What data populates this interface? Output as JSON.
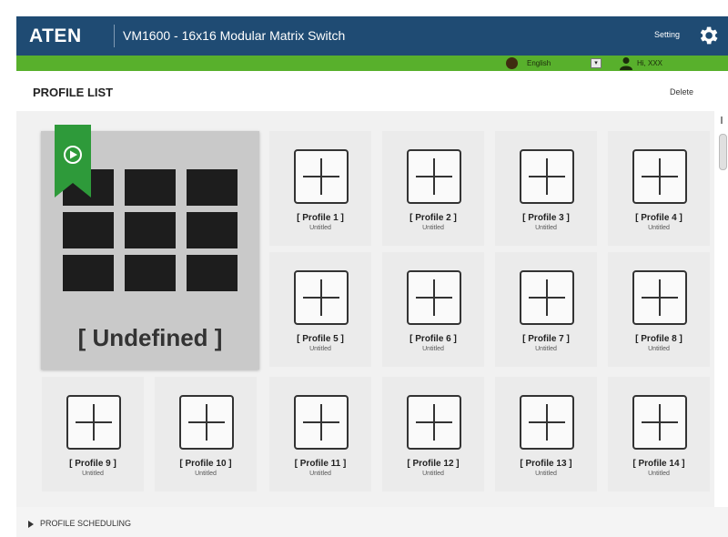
{
  "header": {
    "logo": "ATEN",
    "title": "VM1600 - 16x16 Modular Matrix Switch",
    "setting_label": "Setting",
    "bar_color": "#1f4b73",
    "setting_icon": "gear-icon"
  },
  "toolbar": {
    "language_icon": "globe-icon",
    "language": "English",
    "user_icon": "user-icon",
    "user": "Hi, XXX",
    "accent_color": "#58b02c"
  },
  "profile_list": {
    "title": "PROFILE LIST",
    "delete_label": "Delete",
    "active_profile": {
      "name": "[ Undefined ]",
      "play_icon": "play-icon"
    },
    "profiles": [
      {
        "name": "[ Profile 1 ]",
        "sub": "Untitled"
      },
      {
        "name": "[ Profile 2 ]",
        "sub": "Untitled"
      },
      {
        "name": "[ Profile 3 ]",
        "sub": "Untitled"
      },
      {
        "name": "[ Profile 4 ]",
        "sub": "Untitled"
      },
      {
        "name": "[ Profile 5 ]",
        "sub": "Untitled"
      },
      {
        "name": "[ Profile 6 ]",
        "sub": "Untitled"
      },
      {
        "name": "[ Profile 7 ]",
        "sub": "Untitled"
      },
      {
        "name": "[ Profile 8 ]",
        "sub": "Untitled"
      },
      {
        "name": "[ Profile 9 ]",
        "sub": "Untitled"
      },
      {
        "name": "[ Profile 10 ]",
        "sub": "Untitled"
      },
      {
        "name": "[ Profile 11 ]",
        "sub": "Untitled"
      },
      {
        "name": "[ Profile 12 ]",
        "sub": "Untitled"
      },
      {
        "name": "[ Profile 13 ]",
        "sub": "Untitled"
      },
      {
        "name": "[ Profile 14 ]",
        "sub": "Untitled"
      }
    ]
  },
  "footer": {
    "scheduling_label": "PROFILE SCHEDULING"
  }
}
